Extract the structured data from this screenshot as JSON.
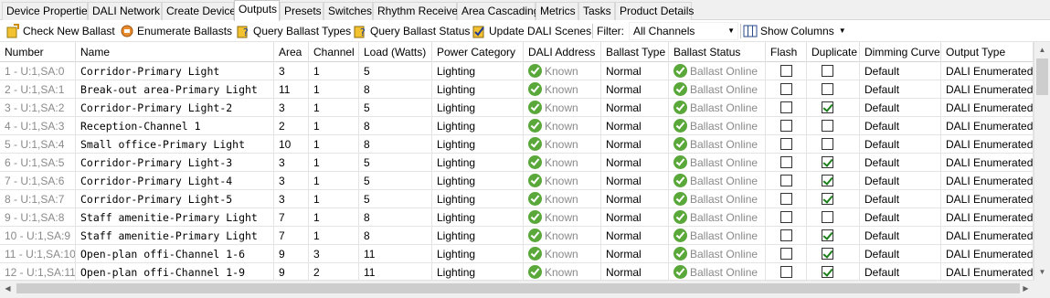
{
  "tabs": [
    {
      "label": "Device Properties"
    },
    {
      "label": "DALI Network"
    },
    {
      "label": "Create Device"
    },
    {
      "label": "Outputs"
    },
    {
      "label": "Presets"
    },
    {
      "label": "Switches"
    },
    {
      "label": "Rhythm Receive"
    },
    {
      "label": "Area Cascading"
    },
    {
      "label": "Metrics"
    },
    {
      "label": "Tasks"
    },
    {
      "label": "Product Details"
    }
  ],
  "active_tab": "Outputs",
  "toolbar": {
    "check_new_ballast": "Check New Ballast",
    "enumerate_ballasts": "Enumerate Ballasts",
    "query_ballast_types": "Query Ballast Types",
    "query_ballast_status": "Query Ballast Status",
    "update_dali_scenes": "Update DALI Scenes",
    "filter_label": "Filter:",
    "filter_value": "All Channels",
    "show_columns": "Show Columns"
  },
  "columns": {
    "number": "Number",
    "name": "Name",
    "area": "Area",
    "channel": "Channel",
    "load": "Load (Watts)",
    "power_category": "Power Category",
    "dali_address": "DALI Address",
    "ballast_type": "Ballast Type",
    "ballast_status": "Ballast Status",
    "flash": "Flash",
    "duplicate": "Duplicate",
    "dimming_curve": "Dimming Curve",
    "output_type": "Output Type"
  },
  "rows": [
    {
      "number": "1 - U:1,SA:0",
      "name": "Corridor-Primary Light",
      "area": "3",
      "channel": "1",
      "load": "5",
      "power_category": "Lighting",
      "dali_address": "Known",
      "ballast_type": "Normal",
      "ballast_status": "Ballast Online",
      "flash": false,
      "duplicate": false,
      "dimming_curve": "Default",
      "output_type": "DALI Enumerated"
    },
    {
      "number": "2 - U:1,SA:1",
      "name": "Break-out area-Primary Light",
      "area": "11",
      "channel": "1",
      "load": "8",
      "power_category": "Lighting",
      "dali_address": "Known",
      "ballast_type": "Normal",
      "ballast_status": "Ballast Online",
      "flash": false,
      "duplicate": false,
      "dimming_curve": "Default",
      "output_type": "DALI Enumerated"
    },
    {
      "number": "3 - U:1,SA:2",
      "name": "Corridor-Primary Light-2",
      "area": "3",
      "channel": "1",
      "load": "5",
      "power_category": "Lighting",
      "dali_address": "Known",
      "ballast_type": "Normal",
      "ballast_status": "Ballast Online",
      "flash": false,
      "duplicate": true,
      "dimming_curve": "Default",
      "output_type": "DALI Enumerated"
    },
    {
      "number": "4 - U:1,SA:3",
      "name": "Reception-Channel 1",
      "area": "2",
      "channel": "1",
      "load": "8",
      "power_category": "Lighting",
      "dali_address": "Known",
      "ballast_type": "Normal",
      "ballast_status": "Ballast Online",
      "flash": false,
      "duplicate": false,
      "dimming_curve": "Default",
      "output_type": "DALI Enumerated"
    },
    {
      "number": "5 - U:1,SA:4",
      "name": "Small office-Primary Light",
      "area": "10",
      "channel": "1",
      "load": "8",
      "power_category": "Lighting",
      "dali_address": "Known",
      "ballast_type": "Normal",
      "ballast_status": "Ballast Online",
      "flash": false,
      "duplicate": false,
      "dimming_curve": "Default",
      "output_type": "DALI Enumerated"
    },
    {
      "number": "6 - U:1,SA:5",
      "name": "Corridor-Primary Light-3",
      "area": "3",
      "channel": "1",
      "load": "5",
      "power_category": "Lighting",
      "dali_address": "Known",
      "ballast_type": "Normal",
      "ballast_status": "Ballast Online",
      "flash": false,
      "duplicate": true,
      "dimming_curve": "Default",
      "output_type": "DALI Enumerated"
    },
    {
      "number": "7 - U:1,SA:6",
      "name": "Corridor-Primary Light-4",
      "area": "3",
      "channel": "1",
      "load": "5",
      "power_category": "Lighting",
      "dali_address": "Known",
      "ballast_type": "Normal",
      "ballast_status": "Ballast Online",
      "flash": false,
      "duplicate": true,
      "dimming_curve": "Default",
      "output_type": "DALI Enumerated"
    },
    {
      "number": "8 - U:1,SA:7",
      "name": "Corridor-Primary Light-5",
      "area": "3",
      "channel": "1",
      "load": "5",
      "power_category": "Lighting",
      "dali_address": "Known",
      "ballast_type": "Normal",
      "ballast_status": "Ballast Online",
      "flash": false,
      "duplicate": true,
      "dimming_curve": "Default",
      "output_type": "DALI Enumerated"
    },
    {
      "number": "9 - U:1,SA:8",
      "name": "Staff amenitie-Primary Light",
      "area": "7",
      "channel": "1",
      "load": "8",
      "power_category": "Lighting",
      "dali_address": "Known",
      "ballast_type": "Normal",
      "ballast_status": "Ballast Online",
      "flash": false,
      "duplicate": false,
      "dimming_curve": "Default",
      "output_type": "DALI Enumerated"
    },
    {
      "number": "10 - U:1,SA:9",
      "name": "Staff amenitie-Primary Light",
      "area": "7",
      "channel": "1",
      "load": "8",
      "power_category": "Lighting",
      "dali_address": "Known",
      "ballast_type": "Normal",
      "ballast_status": "Ballast Online",
      "flash": false,
      "duplicate": true,
      "dimming_curve": "Default",
      "output_type": "DALI Enumerated"
    },
    {
      "number": "11 - U:1,SA:10",
      "name": "Open-plan offi-Channel 1-6",
      "area": "9",
      "channel": "3",
      "load": "11",
      "power_category": "Lighting",
      "dali_address": "Known",
      "ballast_type": "Normal",
      "ballast_status": "Ballast Online",
      "flash": false,
      "duplicate": true,
      "dimming_curve": "Default",
      "output_type": "DALI Enumerated"
    },
    {
      "number": "12 - U:1,SA:11",
      "name": "Open-plan offi-Channel 1-9",
      "area": "9",
      "channel": "2",
      "load": "11",
      "power_category": "Lighting",
      "dali_address": "Known",
      "ballast_type": "Normal",
      "ballast_status": "Ballast Online",
      "flash": false,
      "duplicate": true,
      "dimming_curve": "Default",
      "output_type": "DALI Enumerated"
    }
  ]
}
